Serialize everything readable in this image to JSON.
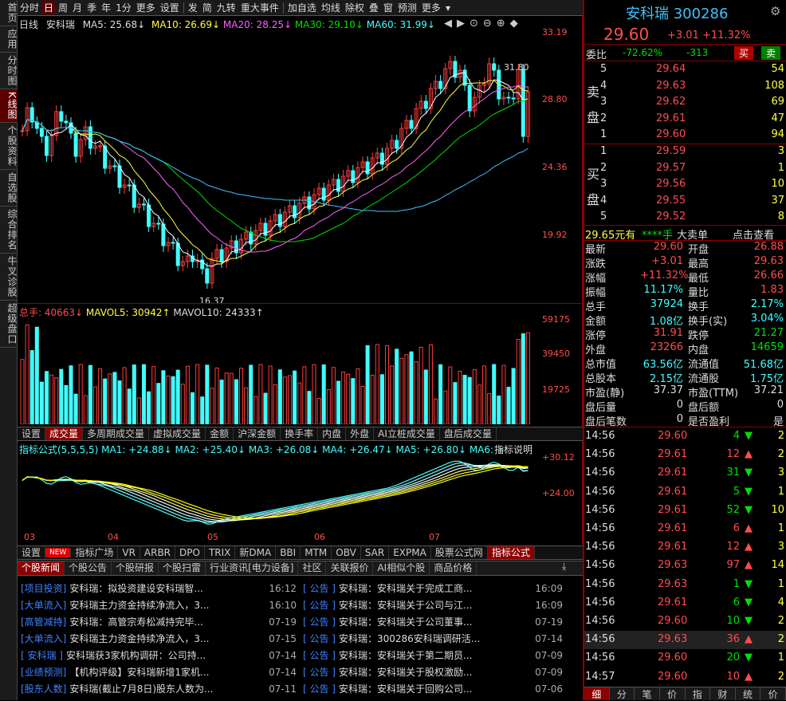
{
  "left_tabs": [
    "首页",
    "应用",
    "分时图",
    "K线图",
    "个股资料",
    "自选股",
    "综合排名",
    "牛叉诊股",
    "超级盘口"
  ],
  "toolbar": [
    "分时",
    "日",
    "周",
    "月",
    "季",
    "年",
    "1分",
    "更多",
    "设置",
    "发",
    "简",
    "九转",
    "重大事件",
    "加自选",
    "均线",
    "除权",
    "叠",
    "窗",
    "预测",
    "更多"
  ],
  "chart_header": {
    "period": "日线",
    "name": "安科瑞",
    "ma5": "MA5: 25.68↓",
    "ma10": "MA10: 26.69↓",
    "ma20": "MA20: 28.25↓",
    "ma30": "MA30: 29.10↓",
    "ma60": "MA60: 31.99↓"
  },
  "price_axis": [
    "33.19",
    "28.80",
    "24.36",
    "19.92"
  ],
  "hi_label": "31.80",
  "lo_label": "16.37",
  "mark_cai": "财",
  "mark_q": "q",
  "mark_l": "L",
  "vol_header": {
    "total": "总手: 40663↓",
    "mavol5": "MAVOL5: 30942↑",
    "mavol10": "MAVOL10: 24333↑"
  },
  "vol_axis": [
    "59175",
    "39450",
    "19725"
  ],
  "vol_tabs": [
    "设置",
    "成交量",
    "多周期成交量",
    "虚拟成交量",
    "金额",
    "沪深金额",
    "换手率",
    "内盘",
    "外盘",
    "AI立桩成交量",
    "盘后成交量"
  ],
  "ind_header": "指标公式(5,5,5,5) MA1: +24.88↓ MA2: +25.40↓ MA3: +26.08↓ MA4: +26.47↓ MA5: +26.80↓ MA6: +27.25↓ MA7:",
  "ind_desc": "指标说明",
  "ind_axis": [
    "+30.12",
    "+24.00"
  ],
  "months": [
    "03",
    "04",
    "05",
    "06",
    "07"
  ],
  "ind_tabs": [
    "设置",
    "NEW",
    "指标广场",
    "VR",
    "ARBR",
    "DPO",
    "TRIX",
    "新DMA",
    "BBI",
    "MTM",
    "OBV",
    "SAR",
    "EXPMA",
    "股票公式网",
    "指标公式"
  ],
  "news_tabs": [
    "个股新闻",
    "个股公告",
    "个股研报",
    "个股扫雷",
    "行业资讯[电力设备]",
    "社区",
    "关联报价",
    "AI相似个股",
    "商品价格"
  ],
  "news_left": [
    [
      "[项目投资]",
      "安科瑞：拟投资建设安科瑞智...",
      "16:12"
    ],
    [
      "[大单流入]",
      "安科瑞主力资金持续净流入，3...",
      "16:10"
    ],
    [
      "[高管减持]",
      "安科瑞：高管宗寿松减持完毕...",
      "07-19"
    ],
    [
      "[大单流入]",
      "安科瑞主力资金持续净流入，3...",
      "07-15"
    ],
    [
      "[ 安科瑞 ]",
      "安科瑞获3家机构调研：公司持...",
      "07-14"
    ],
    [
      "[业绩预测]",
      "【机构评级】安科瑞新增1家机...",
      "07-14"
    ],
    [
      "[股东人数]",
      "安科瑞(截止7月8日)股东人数为...",
      "07-11"
    ]
  ],
  "news_right": [
    [
      "[ 公告 ]",
      "安科瑞：安科瑞关于完成工商...",
      "16:09"
    ],
    [
      "[ 公告 ]",
      "安科瑞：安科瑞关于公司与江...",
      "16:09"
    ],
    [
      "[ 公告 ]",
      "安科瑞：安科瑞关于公司董事...",
      "07-19"
    ],
    [
      "[ 公告 ]",
      "安科瑞：300286安科瑞调研活...",
      "07-14"
    ],
    [
      "[ 公告 ]",
      "安科瑞：安科瑞关于第二期员...",
      "07-09"
    ],
    [
      "[ 公告 ]",
      "安科瑞：安科瑞关于股权激励...",
      "07-09"
    ],
    [
      "[ 公告 ]",
      "安科瑞：安科瑞关于回购公司...",
      "07-06"
    ]
  ],
  "stock": {
    "name": "安科瑞",
    "code": "300286",
    "price": "29.60",
    "chg": "+3.01",
    "pct": "+11.32%"
  },
  "weibi": {
    "label": "委比",
    "pct": "-72.62%",
    "diff": "-313",
    "buy": "买",
    "sell": "卖"
  },
  "sell_lbl": "卖盘",
  "buy_lbl": "买盘",
  "asks": [
    [
      "5",
      "29.64",
      "54"
    ],
    [
      "4",
      "29.63",
      "108"
    ],
    [
      "3",
      "29.62",
      "69"
    ],
    [
      "2",
      "29.61",
      "47"
    ],
    [
      "1",
      "29.60",
      "94"
    ]
  ],
  "bids": [
    [
      "1",
      "29.59",
      "3"
    ],
    [
      "2",
      "29.57",
      "1"
    ],
    [
      "3",
      "29.56",
      "10"
    ],
    [
      "4",
      "29.55",
      "37"
    ],
    [
      "5",
      "29.52",
      "8"
    ]
  ],
  "bigorder": {
    "a": "29.65元有",
    "b": "****手",
    "c": "大卖单",
    "d": "点击查看"
  },
  "quote": [
    [
      "最新",
      "29.60",
      "开盘",
      "26.88"
    ],
    [
      "涨跌",
      "+3.01",
      "最高",
      "29.63"
    ],
    [
      "涨幅",
      "+11.32%",
      "最低",
      "26.66"
    ],
    [
      "振幅",
      "11.17%",
      "量比",
      "1.83"
    ],
    [
      "总手",
      "37924",
      "换手",
      "2.17%"
    ],
    [
      "金额",
      "1.08亿",
      "换手(实)",
      "3.04%"
    ],
    [
      "涨停",
      "31.91",
      "跌停",
      "21.27"
    ],
    [
      "外盘",
      "23266",
      "内盘",
      "14659"
    ],
    [
      "总市值",
      "63.56亿",
      "流通值",
      "51.68亿"
    ],
    [
      "总股本",
      "2.15亿",
      "流通股",
      "1.75亿"
    ],
    [
      "市盈(静)",
      "37.37",
      "市盈(TTM)",
      "37.21"
    ],
    [
      "盘后量",
      "0",
      "盘后额",
      "0"
    ],
    [
      "盘后笔数",
      "0",
      "是否盈利",
      "是"
    ]
  ],
  "ticks": [
    [
      "14:56",
      "29.60",
      "4",
      "d",
      "2"
    ],
    [
      "14:56",
      "29.61",
      "12",
      "u",
      "2"
    ],
    [
      "14:56",
      "29.61",
      "31",
      "d",
      "3"
    ],
    [
      "14:56",
      "29.61",
      "5",
      "d",
      "1"
    ],
    [
      "14:56",
      "29.61",
      "52",
      "d",
      "10"
    ],
    [
      "14:56",
      "29.61",
      "6",
      "u",
      "1"
    ],
    [
      "14:56",
      "29.61",
      "12",
      "u",
      "3"
    ],
    [
      "14:56",
      "29.63",
      "97",
      "u",
      "14"
    ],
    [
      "14:56",
      "29.63",
      "1",
      "d",
      "1"
    ],
    [
      "14:56",
      "29.61",
      "6",
      "d",
      "4"
    ],
    [
      "14:56",
      "29.60",
      "10",
      "d",
      "2"
    ],
    [
      "14:56",
      "29.63",
      "36",
      "u",
      "2"
    ],
    [
      "14:56",
      "29.60",
      "20",
      "d",
      "1"
    ],
    [
      "14:57",
      "29.60",
      "10",
      "u",
      "2"
    ]
  ],
  "bottom_tabs": [
    "细",
    "分",
    "笔",
    "价",
    "指",
    "财",
    "统",
    "价"
  ]
}
